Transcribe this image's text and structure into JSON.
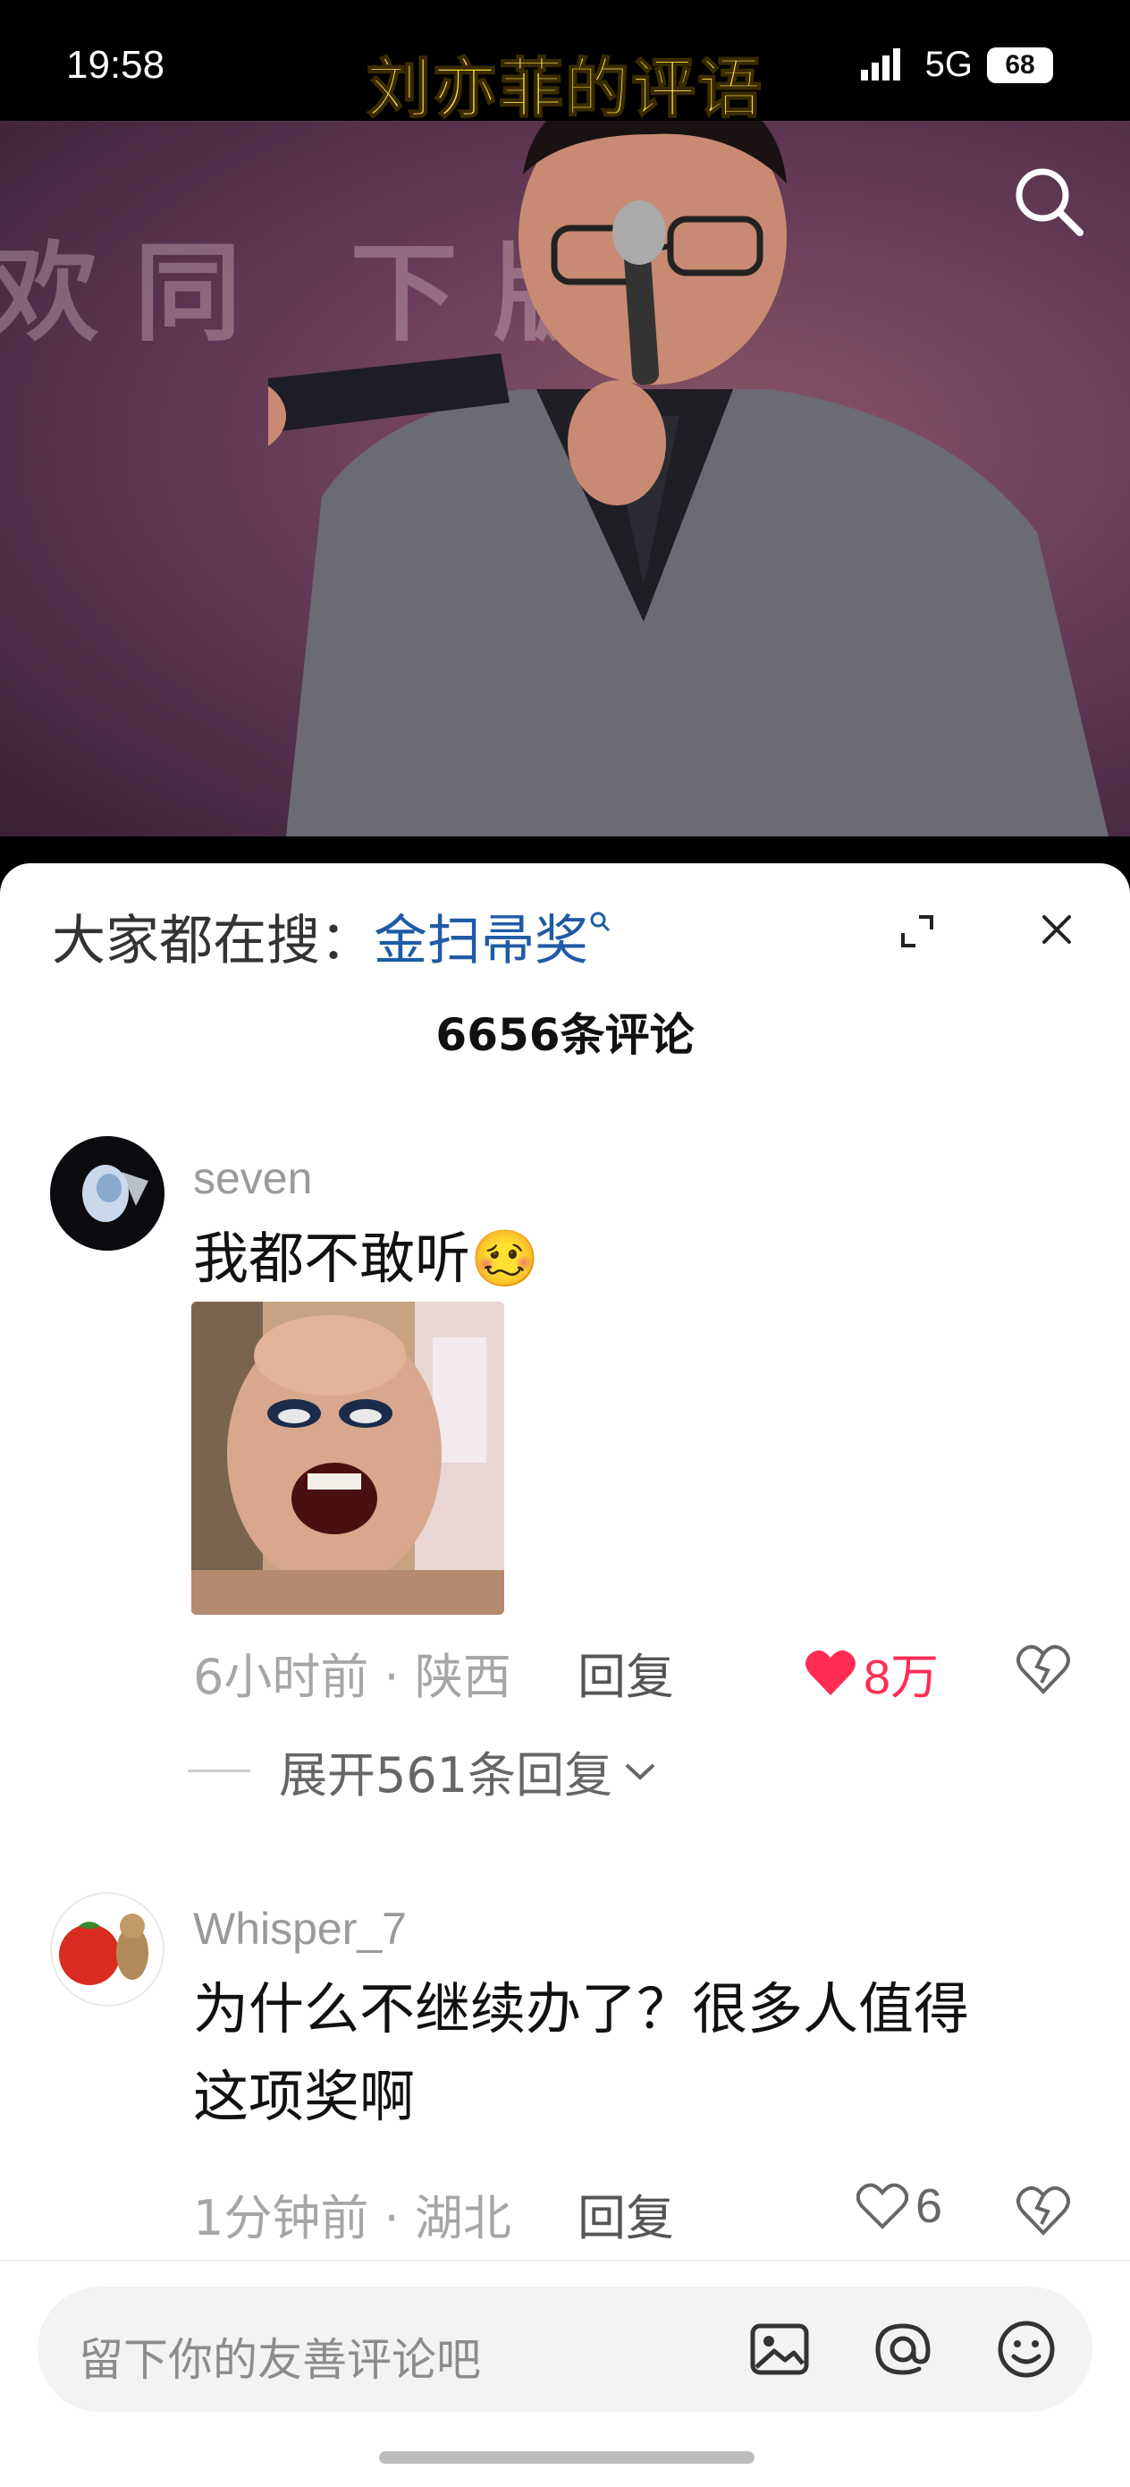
{
  "status_bar": {
    "time": "19:58",
    "network": "5G",
    "battery": "68"
  },
  "video": {
    "caption": "刘亦菲的评语",
    "background_text": "欢同  下版"
  },
  "sheet": {
    "hot_search_prefix": "大家都在搜：",
    "hot_search_term": "金扫帚奖",
    "comment_count": "6656条评论"
  },
  "comments": [
    {
      "username": "seven",
      "text": "我都不敢听",
      "emoji": "🥴",
      "time_location": "6小时前 · 陕西",
      "reply_label": "回复",
      "likes": "8万",
      "liked": true,
      "expand_replies": "展开561条回复"
    },
    {
      "username": "Whisper_7",
      "text_line1": "为什么不继续办了？很多人值得",
      "text_line2": "这项奖啊",
      "time_location": "1分钟前 · 湖北",
      "reply_label": "回复",
      "likes": "6",
      "liked": false
    }
  ],
  "input": {
    "placeholder": "留下你的友善评论吧"
  },
  "colors": {
    "accent_red": "#ff2d55",
    "link_blue": "#1f5ba6",
    "caption_yellow": "#ffe94a"
  },
  "icons": [
    "search-icon",
    "expand-icon",
    "close-icon",
    "heart-icon",
    "dislike-icon",
    "image-icon",
    "at-icon",
    "emoji-icon"
  ]
}
